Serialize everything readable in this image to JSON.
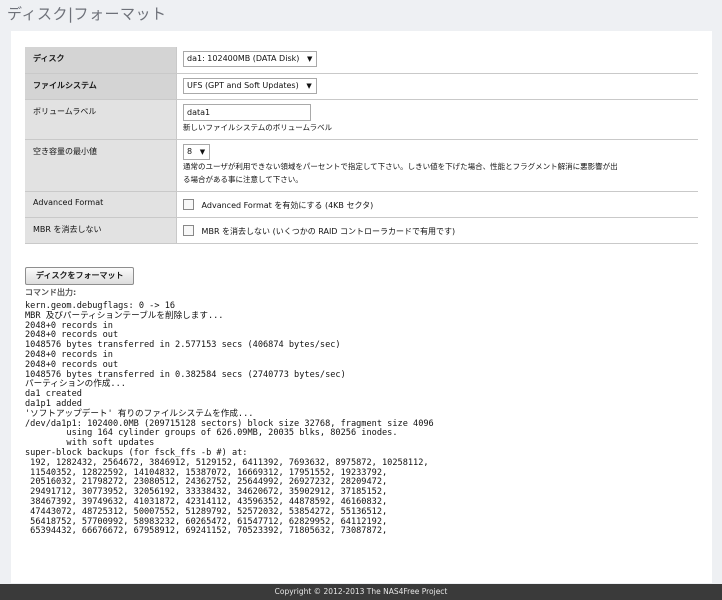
{
  "page": {
    "title": "ディスク|フォーマット"
  },
  "form": {
    "disk": {
      "label": "ディスク",
      "value": "da1: 102400MB (DATA Disk)"
    },
    "filesystem": {
      "label": "ファイルシステム",
      "value": "UFS (GPT and Soft Updates)"
    },
    "volume_label": {
      "label": "ボリュームラベル",
      "value": "data1",
      "note": "新しいファイルシステムのボリュームラベル"
    },
    "min_free": {
      "label": "空き容量の最小値",
      "value": "8",
      "note1": "通常のユーザが利用できない領域をパーセントで指定して下さい。しきい値を下げた場合、性能とフラグメント解消に悪影響が出",
      "note2": "る場合がある事に注意して下さい。"
    },
    "advanced_format": {
      "label": "Advanced Format",
      "checkbox_label": "Advanced Format を有効にする (4KB セクタ)"
    },
    "keep_mbr": {
      "label": "MBR を消去しない",
      "checkbox_label": "MBR を消去しない (いくつかの RAID コントローラカードで有用です)"
    }
  },
  "actions": {
    "format_button": "ディスクをフォーマット"
  },
  "output": {
    "label": "コマンド出力:",
    "text": "kern.geom.debugflags: 0 -> 16\nMBR 及びパーティションテーブルを削除します...\n2048+0 records in\n2048+0 records out\n1048576 bytes transferred in 2.577153 secs (406874 bytes/sec)\n2048+0 records in\n2048+0 records out\n1048576 bytes transferred in 0.382584 secs (2740773 bytes/sec)\nパーティションの作成...\nda1 created\nda1p1 added\n'ソフトアップデート' 有りのファイルシステムを作成...\n/dev/da1p1: 102400.0MB (209715128 sectors) block size 32768, fragment size 4096\n        using 164 cylinder groups of 626.09MB, 20035 blks, 80256 inodes.\n        with soft updates\nsuper-block backups (for fsck_ffs -b #) at:\n 192, 1282432, 2564672, 3846912, 5129152, 6411392, 7693632, 8975872, 10258112,\n 11540352, 12822592, 14104832, 15387072, 16669312, 17951552, 19233792,\n 20516032, 21798272, 23080512, 24362752, 25644992, 26927232, 28209472,\n 29491712, 30773952, 32056192, 33338432, 34620672, 35902912, 37185152,\n 38467392, 39749632, 41031872, 42314112, 43596352, 44878592, 46160832,\n 47443072, 48725312, 50007552, 51289792, 52572032, 53854272, 55136512,\n 56418752, 57700992, 58983232, 60265472, 61547712, 62829952, 64112192,\n 65394432, 66676672, 67958912, 69241152, 70523392, 71805632, 73087872,"
  },
  "footer": {
    "text": "Copyright © 2012-2013 The NAS4Free Project"
  }
}
